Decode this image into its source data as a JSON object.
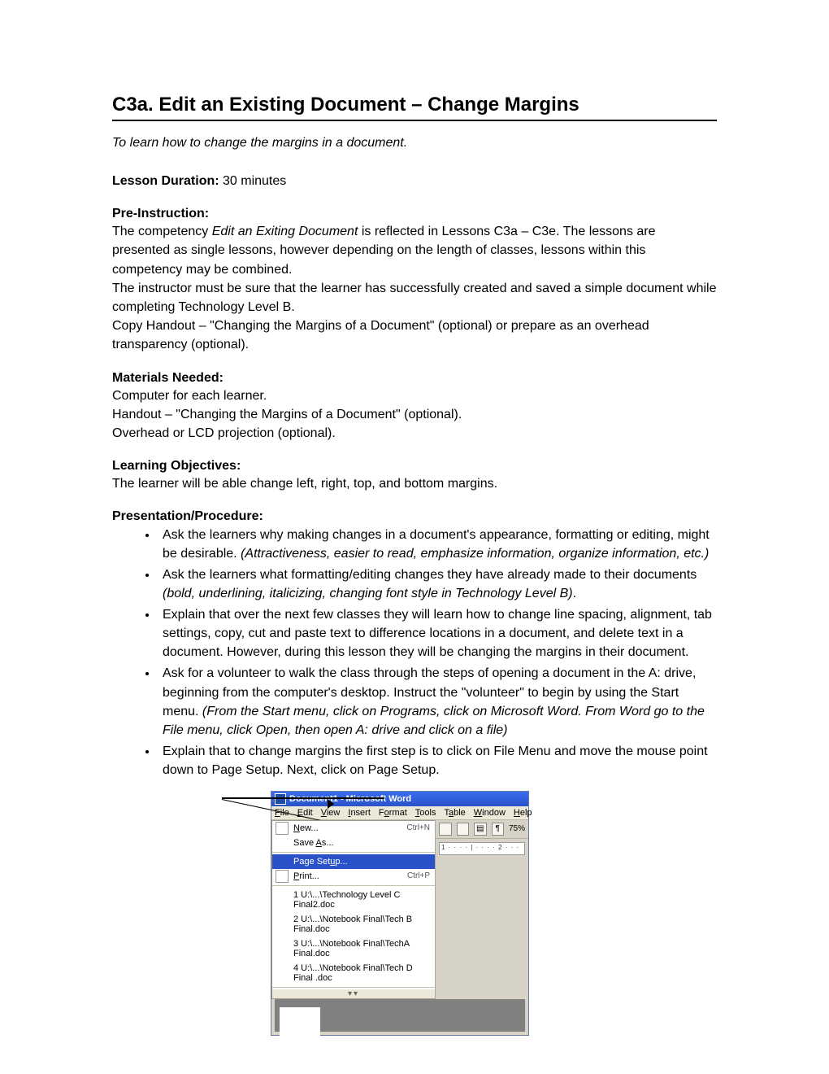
{
  "title": "C3a.  Edit an Existing Document – Change Margins",
  "subtitle": "To learn how to change the margins in a document.",
  "duration_label": "Lesson Duration:",
  "duration_value": "  30 minutes",
  "preinstruction_label": "Pre-Instruction:",
  "preinstruction_body_a": "The competency ",
  "preinstruction_body_b": "Edit an Exiting Document",
  "preinstruction_body_c": " is reflected in Lessons C3a – C3e.  The lessons are presented as single lessons, however depending on the length of classes, lessons within this competency may be combined.",
  "preinstruction_body_d": "The instructor must be sure that the learner has successfully created and saved a simple document while completing Technology Level B.",
  "preinstruction_body_e": "Copy Handout – \"Changing the Margins of a Document\" (optional) or prepare as an overhead transparency (optional).",
  "materials_label": "Materials Needed:",
  "materials_1": "Computer for each learner.",
  "materials_2": "Handout – \"Changing the Margins of a Document\" (optional).",
  "materials_3": "Overhead or LCD projection (optional).",
  "objectives_label": "Learning Objectives:",
  "objectives_body": "The learner will be able change left, right, top, and bottom margins.",
  "procedure_label": "Presentation/Procedure:",
  "bullets": [
    {
      "a": "Ask the learners why making changes in a document's appearance, formatting or editing, might be desirable.  ",
      "b": "(Attractiveness, easier to read, emphasize information, organize information, etc.)"
    },
    {
      "a": "Ask the learners what formatting/editing changes they have already made to their documents ",
      "b": "(bold, underlining, italicizing, changing font style in Technology Level B)",
      "c": "."
    },
    {
      "a": "Explain that over the next few classes they will learn how to change line spacing, alignment, tab settings, copy, cut and paste text to difference locations in a document, and delete text in a document.  However, during this lesson they will be changing the margins in their document."
    },
    {
      "a": "Ask for a volunteer to walk the class through the steps of opening a document in the A: drive, beginning from the computer's desktop.  Instruct the \"volunteer\" to begin by using the Start menu.  ",
      "b": "(From the Start menu, click on Programs, click on Microsoft Word.  From Word go to the File menu, click Open, then open A: drive and click on a file)"
    },
    {
      "a": "Explain that to change margins the first step is to click on File Menu and move the mouse point down to Page Setup.  Next, click on Page Setup."
    }
  ],
  "word": {
    "title": "Document1 - Microsoft Word",
    "menus": [
      "File",
      "Edit",
      "View",
      "Insert",
      "Format",
      "Tools",
      "Table",
      "Window",
      "Help"
    ],
    "items": [
      {
        "label": "New...",
        "shortcut": "Ctrl+N",
        "icon": true
      },
      {
        "label": "Save As..."
      },
      {
        "label": "Page Setup...",
        "sel": true
      },
      {
        "label": "Print...",
        "shortcut": "Ctrl+P",
        "icon": true
      }
    ],
    "recent": [
      "1 U:\\...\\Technology Level C Final2.doc",
      "2 U:\\...\\Notebook Final\\Tech B Final.doc",
      "3 U:\\...\\Notebook Final\\TechA Final.doc",
      "4 U:\\...\\Notebook Final\\Tech D Final .doc"
    ],
    "zoom": "75%"
  }
}
